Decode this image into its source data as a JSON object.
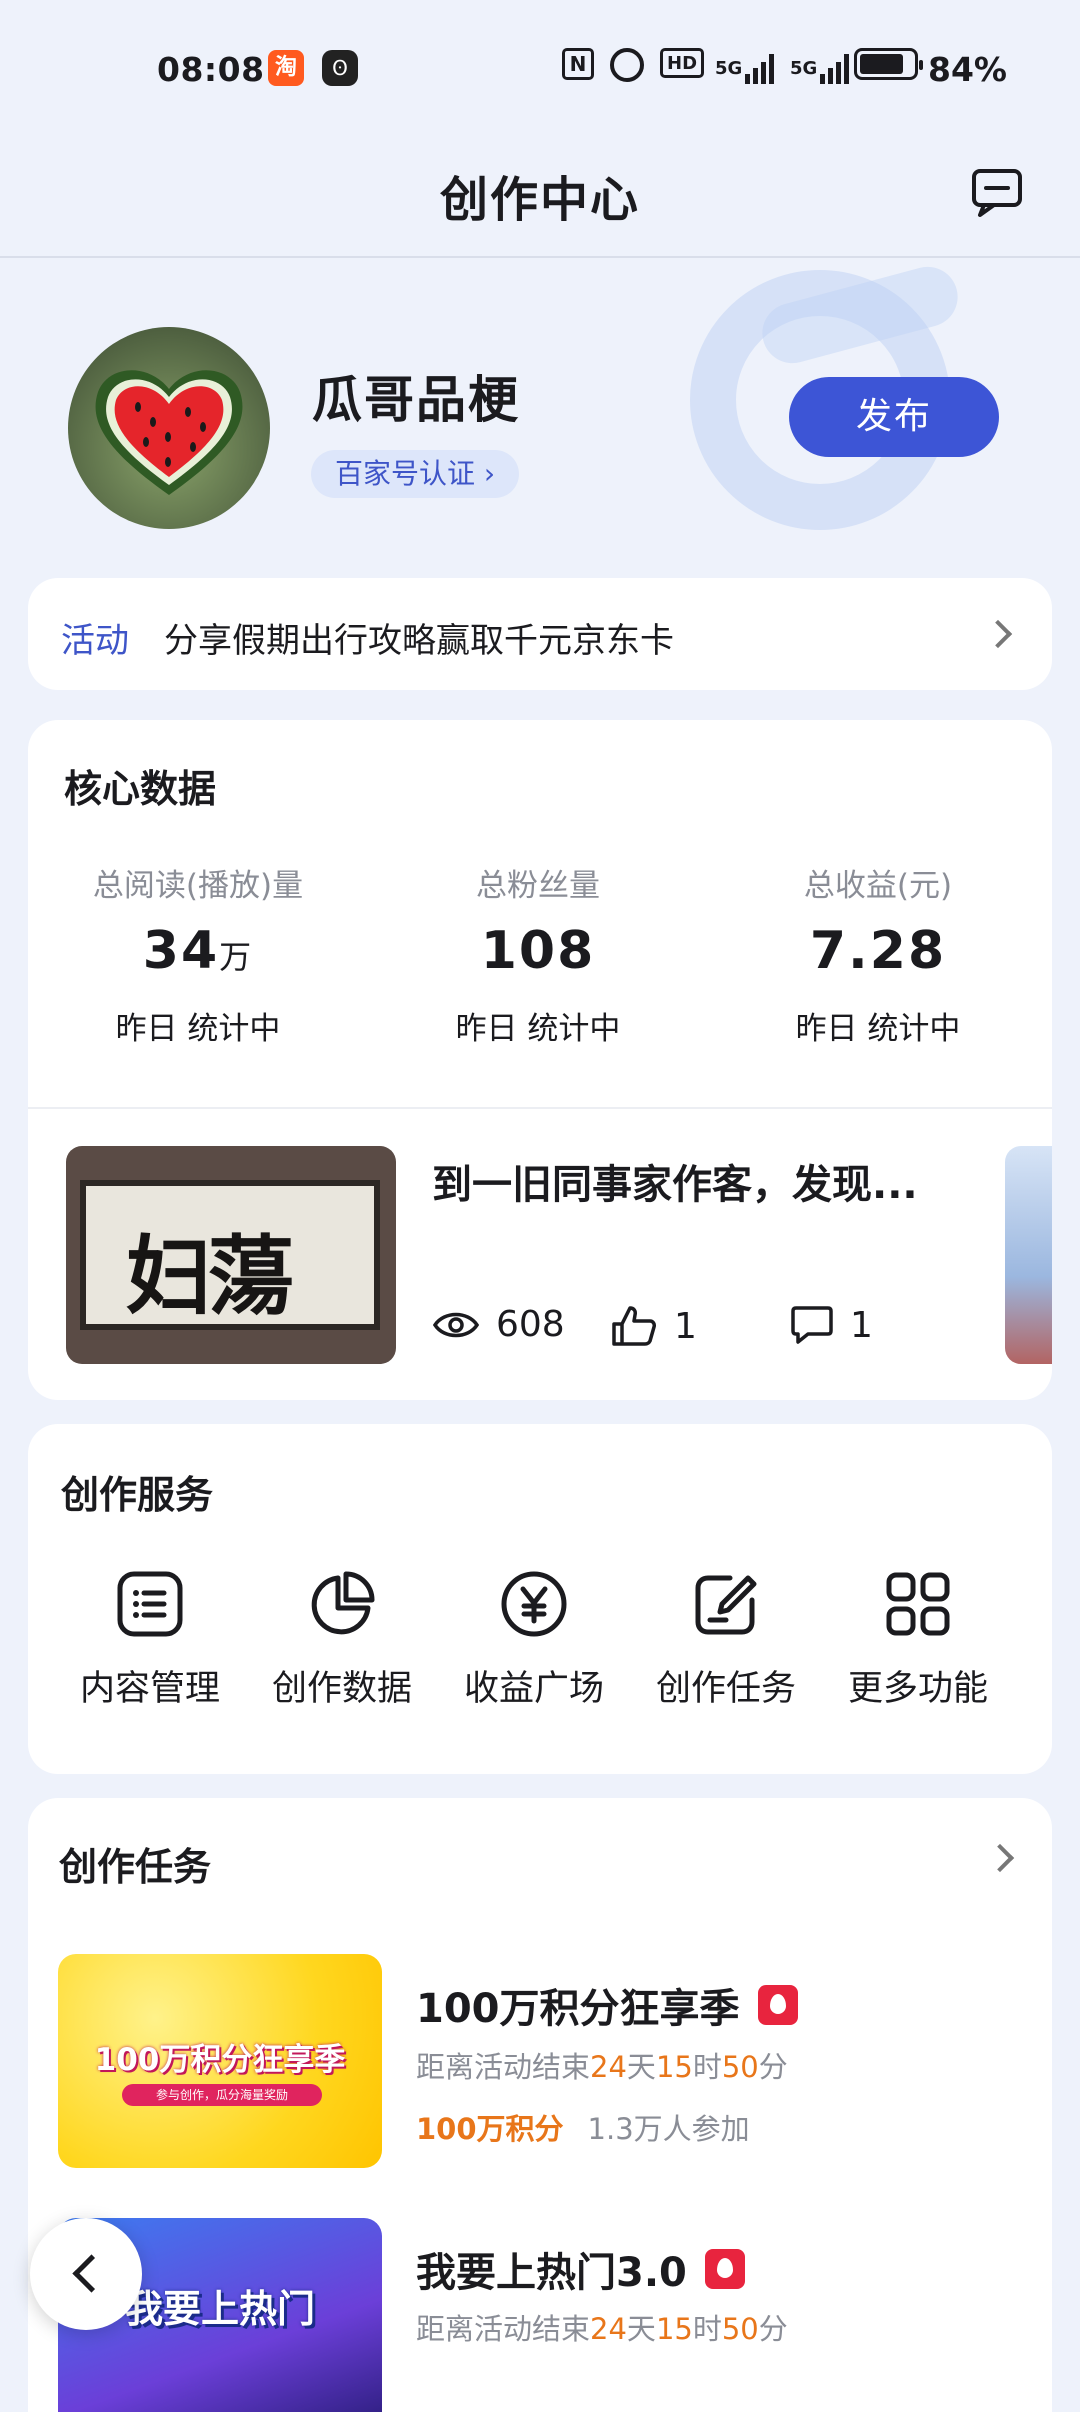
{
  "status_bar": {
    "time": "08:08",
    "taobao_icon": "淘",
    "other_app_icon": "ʘ",
    "nfc": "N",
    "hd": "HD",
    "signal1": "5G",
    "signal2": "5G",
    "battery": "84%"
  },
  "header": {
    "title": "创作中心",
    "message_icon": "message-icon"
  },
  "profile": {
    "nickname": "瓜哥品梗",
    "cert": "百家号认证 ›",
    "publish": "发布"
  },
  "activity": {
    "tag": "活动",
    "text": "分享假期出行攻略赢取千元京东卡"
  },
  "core": {
    "title": "核心数据",
    "stats": [
      {
        "label": "总阅读(播放)量",
        "value": "34",
        "unit": "万",
        "sub": "昨日 统计中"
      },
      {
        "label": "总粉丝量",
        "value": "108",
        "unit": "",
        "sub": "昨日 统计中"
      },
      {
        "label": "总收益(元)",
        "value": "7.28",
        "unit": "",
        "sub": "昨日 统计中"
      }
    ],
    "article": {
      "title": "到一旧同事家作客，发现...",
      "thumb_text": "妇蕩",
      "views": "608",
      "likes": "1",
      "comments": "1"
    }
  },
  "services": {
    "title": "创作服务",
    "items": [
      {
        "label": "内容管理",
        "icon": "list-icon"
      },
      {
        "label": "创作数据",
        "icon": "pie-chart-icon"
      },
      {
        "label": "收益广场",
        "icon": "yen-icon"
      },
      {
        "label": "创作任务",
        "icon": "edit-icon"
      },
      {
        "label": "更多功能",
        "icon": "grid-icon"
      }
    ]
  },
  "tasks": {
    "title": "创作任务",
    "items": [
      {
        "banner": "100万积分狂享季",
        "ribbon": "参与创作，瓜分海量奖励",
        "title": "100万积分狂享季",
        "time_prefix": "距离活动结束",
        "days": "24",
        "days_unit": "天",
        "hours": "15",
        "hours_unit": "时",
        "minutes": "50",
        "minutes_unit": "分",
        "points": "100万积分",
        "participants": "1.3万人参加"
      },
      {
        "banner": "我要上热门",
        "title": "我要上热门3.0",
        "time_prefix": "距离活动结束",
        "days": "24",
        "days_unit": "天",
        "hours": "15",
        "hours_unit": "时",
        "minutes": "50",
        "minutes_unit": "分"
      }
    ]
  }
}
